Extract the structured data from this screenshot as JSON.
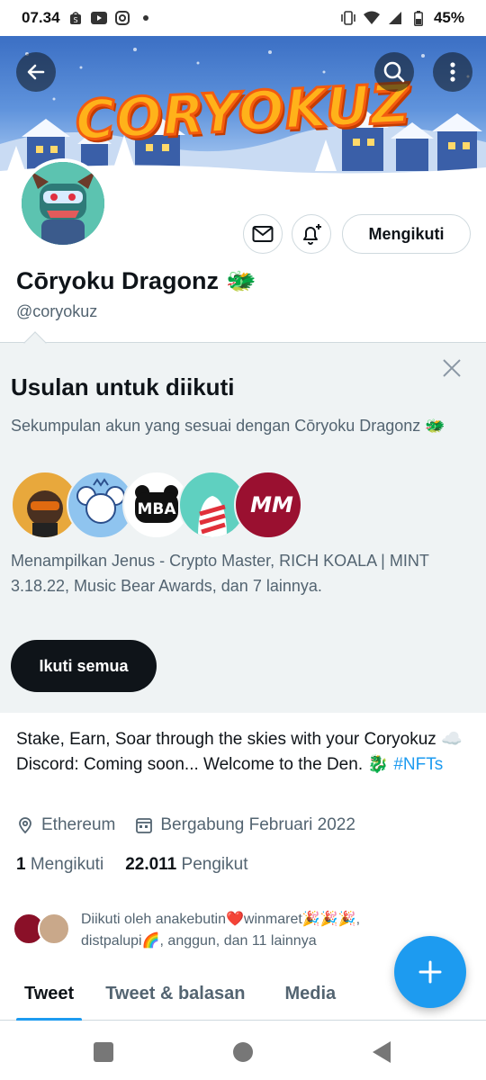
{
  "status_bar": {
    "time": "07.34",
    "battery": "45%",
    "left_icons": [
      "shopping-bag-icon",
      "youtube-icon",
      "instagram-icon",
      "dot-icon"
    ],
    "right_icons": [
      "vibrate-icon",
      "wifi-icon",
      "signal-icon",
      "battery-icon"
    ]
  },
  "banner": {
    "title": "CORYOKUZ"
  },
  "profile": {
    "display_name": "Cōryoku Dragonz",
    "name_emoji": "🐲",
    "handle": "@coryokuz",
    "follow_label": "Mengikuti"
  },
  "suggestions": {
    "title": "Usulan untuk diikuti",
    "description": "Sekumpulan akun yang sesuai dengan Cōryoku Dragonz 🐲",
    "avatars": [
      {
        "name": "jenus-avatar",
        "bg": "#e8a83c",
        "label": ""
      },
      {
        "name": "rich-koala-avatar",
        "bg": "#8fc4ef",
        "label": ""
      },
      {
        "name": "music-bear-avatar",
        "bg": "#ffffff",
        "label": "MBA"
      },
      {
        "name": "candy-avatar",
        "bg": "#5fd0c0",
        "label": ""
      },
      {
        "name": "mm-avatar",
        "bg": "#9a1030",
        "label": "MM"
      }
    ],
    "list_text": "Menampilkan Jenus - Crypto Master, RICH KOALA | MINT 3.18.22, Music Bear Awards, dan 7 lainnya.",
    "follow_all_label": "Ikuti semua"
  },
  "bio": {
    "text": "Stake, Earn, Soar through the skies with your Coryokuz ☁️   Discord: Coming soon...  Welcome to the Den. 🐉 ",
    "hashtag": "#NFTs"
  },
  "meta": {
    "location": "Ethereum",
    "joined": "Bergabung Februari 2022"
  },
  "counts": {
    "following_num": "1",
    "following_label": "Mengikuti",
    "followers_num": "22.011",
    "followers_label": "Pengikut"
  },
  "followed_by": {
    "text": "Diikuti oleh anakebutin❤️winmaret🎉🎉🎉, distpalupi🌈, anggun, dan 11 lainnya"
  },
  "tabs": [
    {
      "label": "Tweet",
      "active": true
    },
    {
      "label": "Tweet & balasan",
      "active": false
    },
    {
      "label": "Media",
      "active": false
    }
  ],
  "colors": {
    "accent": "#1d9bf0",
    "text_primary": "#0f1419",
    "text_secondary": "#536471",
    "panel_bg": "#eff3f4"
  }
}
